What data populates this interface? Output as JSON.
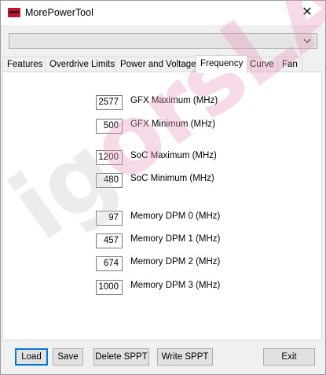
{
  "app": {
    "title": "MorePowerTool",
    "close_glyph": "✕"
  },
  "dropdown": {
    "value": ""
  },
  "tabs": [
    {
      "label": "Features"
    },
    {
      "label": "Overdrive Limits"
    },
    {
      "label": "Power and Voltage"
    },
    {
      "label": "Frequency"
    },
    {
      "label": "Curve"
    },
    {
      "label": "Fan"
    }
  ],
  "active_tab": "Frequency",
  "fields": {
    "gfx_max": {
      "value": "2577",
      "label": "GFX Maximum (MHz)"
    },
    "gfx_min": {
      "value": "500",
      "label": "GFX Minimum (MHz)"
    },
    "soc_max": {
      "value": "1200",
      "label": "SoC Maximum (MHz)"
    },
    "soc_min": {
      "value": "480",
      "label": "SoC Minimum (MHz)"
    },
    "mem_dpm0": {
      "value": "97",
      "label": "Memory DPM 0 (MHz)"
    },
    "mem_dpm1": {
      "value": "457",
      "label": "Memory DPM 1 (MHz)"
    },
    "mem_dpm2": {
      "value": "674",
      "label": "Memory DPM 2 (MHz)"
    },
    "mem_dpm3": {
      "value": "1000",
      "label": "Memory DPM 3 (MHz)"
    }
  },
  "buttons": {
    "load": "Load",
    "save": "Save",
    "delete_sppt": "Delete SPPT",
    "write_sppt": "Write SPPT",
    "exit": "Exit"
  },
  "watermark": {
    "text_a": "ig",
    "text_b": "or",
    "text_c": "sLAB"
  },
  "colors": {
    "accent": "#0078d7",
    "icon_red": "#c8102e"
  }
}
